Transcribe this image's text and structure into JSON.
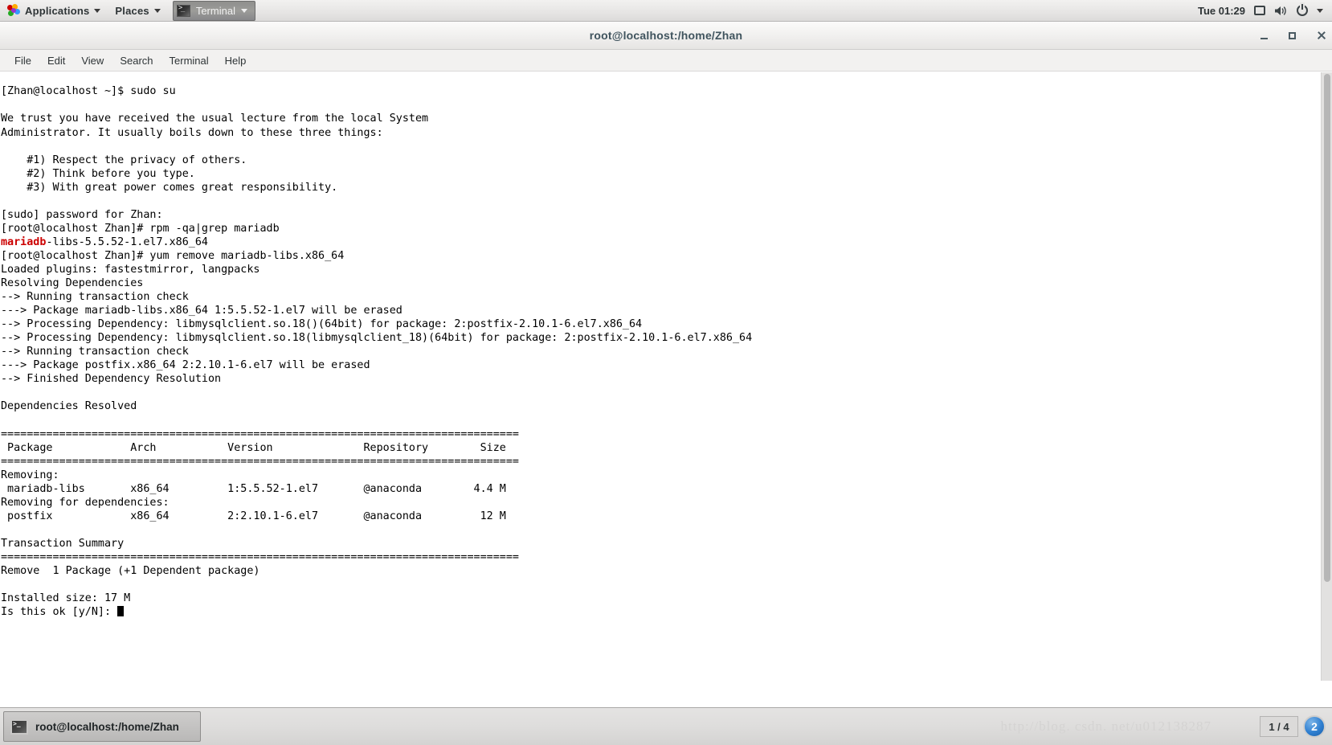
{
  "top_panel": {
    "applications_label": "Applications",
    "places_label": "Places",
    "window_button_label": "Terminal",
    "clock": "Tue 01:29",
    "icons": [
      "gnome-logo-icon",
      "chevron-down-icon",
      "terminal-icon",
      "display-icon",
      "volume-icon",
      "power-icon"
    ]
  },
  "window": {
    "title": "root@localhost:/home/Zhan",
    "controls": {
      "minimize": "minimize-button",
      "maximize": "maximize-button",
      "close": "close-button"
    }
  },
  "menubar": {
    "items": [
      {
        "label": "File"
      },
      {
        "label": "Edit"
      },
      {
        "label": "View"
      },
      {
        "label": "Search"
      },
      {
        "label": "Terminal"
      },
      {
        "label": "Help"
      }
    ]
  },
  "terminal": {
    "lines": [
      "[Zhan@localhost ~]$ sudo su",
      "",
      "We trust you have received the usual lecture from the local System",
      "Administrator. It usually boils down to these three things:",
      "",
      "    #1) Respect the privacy of others.",
      "    #2) Think before you type.",
      "    #3) With great power comes great responsibility.",
      "",
      "[sudo] password for Zhan:",
      "[root@localhost Zhan]# rpm -qa|grep mariadb",
      "@@RED:mariadb@@-libs-5.5.52-1.el7.x86_64",
      "[root@localhost Zhan]# yum remove mariadb-libs.x86_64",
      "Loaded plugins: fastestmirror, langpacks",
      "Resolving Dependencies",
      "--> Running transaction check",
      "---> Package mariadb-libs.x86_64 1:5.5.52-1.el7 will be erased",
      "--> Processing Dependency: libmysqlclient.so.18()(64bit) for package: 2:postfix-2.10.1-6.el7.x86_64",
      "--> Processing Dependency: libmysqlclient.so.18(libmysqlclient_18)(64bit) for package: 2:postfix-2.10.1-6.el7.x86_64",
      "--> Running transaction check",
      "---> Package postfix.x86_64 2:2.10.1-6.el7 will be erased",
      "--> Finished Dependency Resolution",
      "",
      "Dependencies Resolved",
      "",
      "================================================================================",
      " Package            Arch           Version              Repository        Size",
      "================================================================================",
      "Removing:",
      " mariadb-libs       x86_64         1:5.5.52-1.el7       @anaconda        4.4 M",
      "Removing for dependencies:",
      " postfix            x86_64         2:2.10.1-6.el7       @anaconda         12 M",
      "",
      "Transaction Summary",
      "================================================================================",
      "Remove  1 Package (+1 Dependent package)",
      "",
      "Installed size: 17 M",
      "Is this ok [y/N]: @@CURSOR@@"
    ],
    "prompt_user": "[Zhan@localhost ~]$",
    "prompt_root": "[root@localhost Zhan]#",
    "highlight_color": "#cc0000",
    "foreground_color": "#000000",
    "background_color": "#ffffff"
  },
  "transaction_table": {
    "headers": [
      "Package",
      "Arch",
      "Version",
      "Repository",
      "Size"
    ],
    "sections": [
      {
        "title": "Removing:",
        "rows": [
          {
            "package": "mariadb-libs",
            "arch": "x86_64",
            "version": "1:5.5.52-1.el7",
            "repository": "@anaconda",
            "size": "4.4 M"
          }
        ]
      },
      {
        "title": "Removing for dependencies:",
        "rows": [
          {
            "package": "postfix",
            "arch": "x86_64",
            "version": "2:2.10.1-6.el7",
            "repository": "@anaconda",
            "size": "12 M"
          }
        ]
      }
    ],
    "summary_title": "Transaction Summary",
    "summary_line": "Remove  1 Package (+1 Dependent package)",
    "installed_size": "Installed size: 17 M",
    "confirm_prompt": "Is this ok [y/N]:"
  },
  "bottom_panel": {
    "task_label": "root@localhost:/home/Zhan",
    "workspace_indicator": "1 / 4",
    "notification_count": "2",
    "watermark": "http://blog. csdn. net/u012138287"
  }
}
